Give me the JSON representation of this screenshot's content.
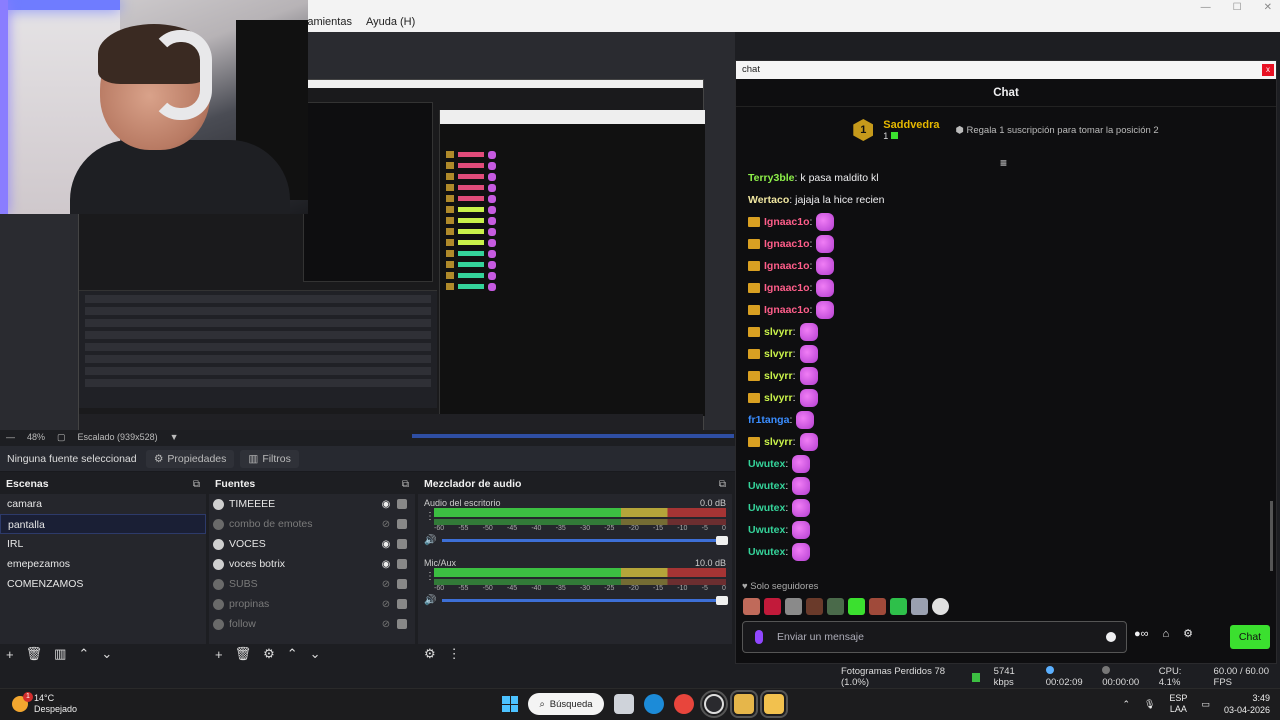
{
  "window": {
    "menu": [
      "rramientas",
      "Ayuda (H)"
    ]
  },
  "zoom": {
    "percent": "48%",
    "scaling": "Escalado (939x528)"
  },
  "context": {
    "source_label": "Ninguna fuente seleccionad",
    "properties_label": "Propiedades",
    "filters_label": "Filtros"
  },
  "scenes": {
    "title": "Escenas",
    "items": [
      "camara",
      "pantalla",
      "IRL",
      "emepezamos",
      "COMENZAMOS"
    ],
    "selected_index": 1
  },
  "sources": {
    "title": "Fuentes",
    "items": [
      {
        "label": "TIMEEEE",
        "visible": true
      },
      {
        "label": "combo de emotes",
        "visible": false
      },
      {
        "label": "VOCES",
        "visible": true
      },
      {
        "label": "voces botrix",
        "visible": true
      },
      {
        "label": "SUBS",
        "visible": false
      },
      {
        "label": "propinas",
        "visible": false
      },
      {
        "label": "follow",
        "visible": false
      }
    ]
  },
  "mixer": {
    "title": "Mezclador de audio",
    "channels": [
      {
        "name": "Audio del escritorio",
        "db": "0.0 dB"
      },
      {
        "name": "Mic/Aux",
        "db": "10.0 dB"
      }
    ],
    "scale": [
      "-60",
      "-55",
      "-50",
      "-45",
      "-40",
      "-35",
      "-30",
      "-25",
      "-20",
      "-15",
      "-10",
      "-5",
      "0"
    ]
  },
  "chat": {
    "window_title": "chat",
    "close": "x",
    "header": "Chat",
    "gift": {
      "badge": "1",
      "user": "Saddvedra",
      "count": "1",
      "message": "Regala 1 suscripción para tomar la posición 2"
    },
    "messages": [
      {
        "user": "Terry3ble",
        "color": "#8ef04a",
        "crown": false,
        "text": "k pasa maldito kl",
        "emote": false
      },
      {
        "user": "Wertaco",
        "color": "#f0e6a0",
        "crown": false,
        "text": "jajaja la hice recien",
        "emote": false
      },
      {
        "user": "Ignaac1o",
        "color": "#ff5e8a",
        "crown": true,
        "text": "",
        "emote": true
      },
      {
        "user": "Ignaac1o",
        "color": "#ff5e8a",
        "crown": true,
        "text": "",
        "emote": true
      },
      {
        "user": "Ignaac1o",
        "color": "#ff5e8a",
        "crown": true,
        "text": "",
        "emote": true
      },
      {
        "user": "Ignaac1o",
        "color": "#ff5e8a",
        "crown": true,
        "text": "",
        "emote": true
      },
      {
        "user": "Ignaac1o",
        "color": "#ff5e8a",
        "crown": true,
        "text": "",
        "emote": true
      },
      {
        "user": "slvyrr",
        "color": "#c9f24a",
        "crown": true,
        "text": "",
        "emote": true
      },
      {
        "user": "slvyrr",
        "color": "#c9f24a",
        "crown": true,
        "text": "",
        "emote": true
      },
      {
        "user": "slvyrr",
        "color": "#c9f24a",
        "crown": true,
        "text": "",
        "emote": true
      },
      {
        "user": "slvyrr",
        "color": "#c9f24a",
        "crown": true,
        "text": "",
        "emote": true
      },
      {
        "user": "fr1tanga",
        "color": "#3a8dff",
        "crown": false,
        "text": "",
        "emote": true
      },
      {
        "user": "slvyrr",
        "color": "#c9f24a",
        "crown": true,
        "text": "",
        "emote": true
      },
      {
        "user": "Uwutex",
        "color": "#35d39a",
        "crown": false,
        "text": "",
        "emote": true
      },
      {
        "user": "Uwutex",
        "color": "#35d39a",
        "crown": false,
        "text": "",
        "emote": true
      },
      {
        "user": "Uwutex",
        "color": "#35d39a",
        "crown": false,
        "text": "",
        "emote": true
      },
      {
        "user": "Uwutex",
        "color": "#35d39a",
        "crown": false,
        "text": "",
        "emote": true
      },
      {
        "user": "Uwutex",
        "color": "#35d39a",
        "crown": false,
        "text": "",
        "emote": true
      }
    ],
    "followers_only": "Solo seguidores",
    "input_placeholder": "Enviar un mensaje",
    "send_label": "Chat"
  },
  "status": {
    "dropped": "Fotogramas Perdidos 78 (1.0%)",
    "bitrate": "5741 kbps",
    "stream_time": "00:02:09",
    "rec_time": "00:00:00",
    "cpu": "CPU: 4.1%",
    "fps": "60.00 / 60.00 FPS"
  },
  "taskbar": {
    "temp": "14°C",
    "weather": "Despejado",
    "alert": "1",
    "search": "Búsqueda",
    "lang1": "ESP",
    "lang2": "LAA",
    "time": "3:49",
    "date": "03-04-2026"
  },
  "colors": {
    "accent_green": "#3be02f",
    "twitch_purple": "#9147ff",
    "obs_blue": "#3d6fd6"
  }
}
